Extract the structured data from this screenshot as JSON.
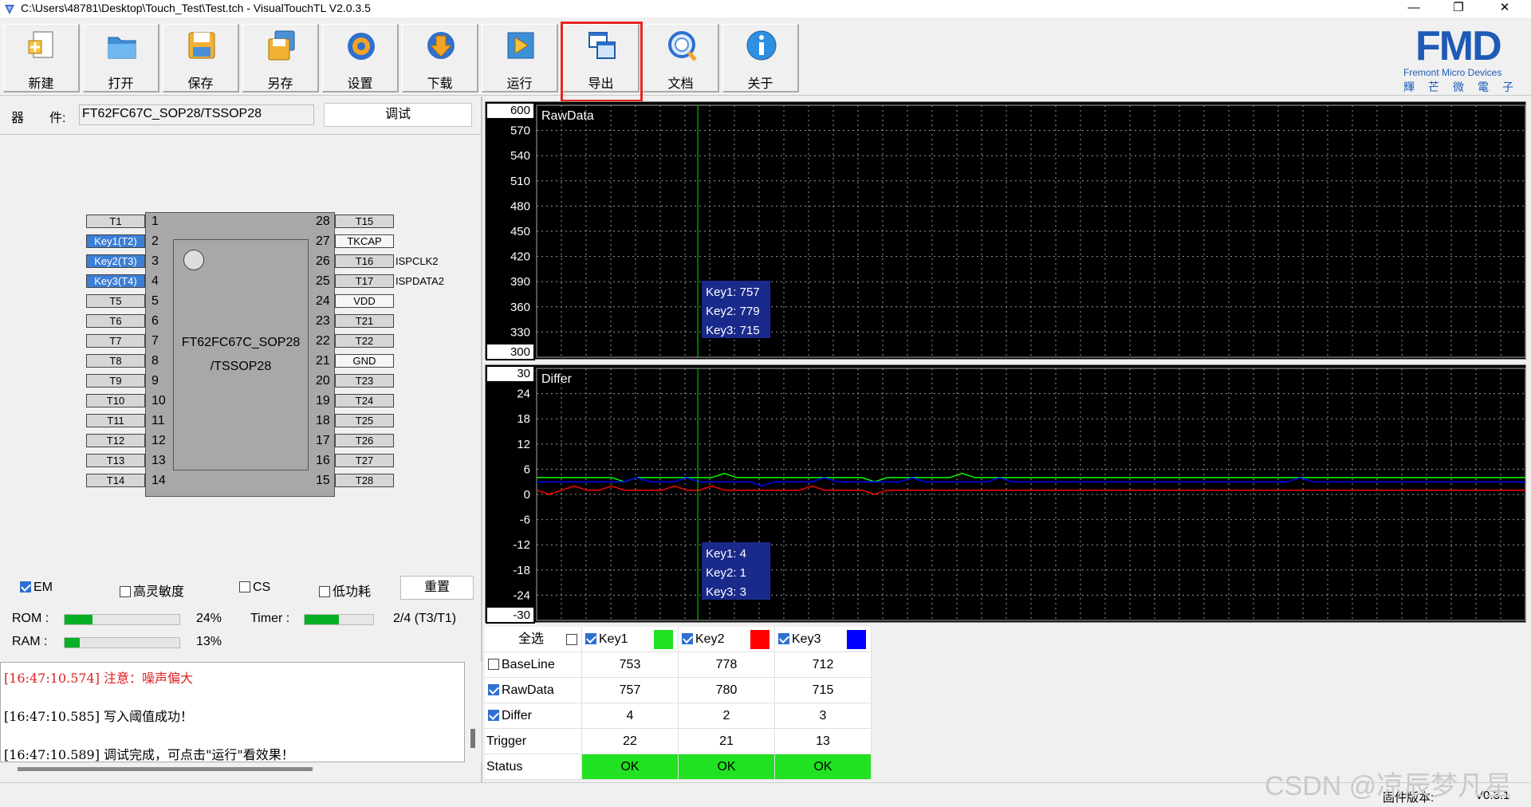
{
  "window": {
    "title": "C:\\Users\\48781\\Desktop\\Touch_Test\\Test.tch - VisualTouchTL V2.0.3.5",
    "min": "—",
    "max": "❐",
    "close": "✕"
  },
  "toolbar": {
    "items": [
      {
        "label": "新建",
        "icon": "new-file-icon"
      },
      {
        "label": "打开",
        "icon": "folder-open-icon"
      },
      {
        "label": "保存",
        "icon": "save-icon"
      },
      {
        "label": "另存",
        "icon": "save-as-icon"
      },
      {
        "label": "设置",
        "icon": "settings-gear-icon"
      },
      {
        "label": "下载",
        "icon": "download-arrow-icon"
      },
      {
        "label": "运行",
        "icon": "run-play-icon"
      },
      {
        "label": "导出",
        "icon": "export-windows-icon"
      },
      {
        "label": "文档",
        "icon": "document-search-icon"
      },
      {
        "label": "关于",
        "icon": "info-icon"
      }
    ],
    "highlight_color": "#e8231f"
  },
  "brand": {
    "logo": "FMD",
    "subtitle": "Fremont Micro Devices",
    "subtitle_cn": "輝芒微電子"
  },
  "device": {
    "label1": "器",
    "label2": "件:",
    "value": "FT62FC67C_SOP28/TSSOP28",
    "debug_button": "调试"
  },
  "chip": {
    "name_line1": "FT62FC67C_SOP28",
    "name_line2": "/TSSOP28",
    "left_pins": [
      {
        "num": "1",
        "label": "T1",
        "selected": false
      },
      {
        "num": "2",
        "label": "Key1(T2)",
        "selected": true
      },
      {
        "num": "3",
        "label": "Key2(T3)",
        "selected": true
      },
      {
        "num": "4",
        "label": "Key3(T4)",
        "selected": true
      },
      {
        "num": "5",
        "label": "T5",
        "selected": false
      },
      {
        "num": "6",
        "label": "T6",
        "selected": false
      },
      {
        "num": "7",
        "label": "T7",
        "selected": false
      },
      {
        "num": "8",
        "label": "T8",
        "selected": false
      },
      {
        "num": "9",
        "label": "T9",
        "selected": false
      },
      {
        "num": "10",
        "label": "T10",
        "selected": false
      },
      {
        "num": "11",
        "label": "T11",
        "selected": false
      },
      {
        "num": "12",
        "label": "T12",
        "selected": false
      },
      {
        "num": "13",
        "label": "T13",
        "selected": false
      },
      {
        "num": "14",
        "label": "T14",
        "selected": false
      }
    ],
    "right_pins": [
      {
        "num": "28",
        "label": "T15",
        "side": "",
        "plain": false
      },
      {
        "num": "27",
        "label": "TKCAP",
        "side": "",
        "plain": true
      },
      {
        "num": "26",
        "label": "T16",
        "side": "ISPCLK2",
        "plain": false
      },
      {
        "num": "25",
        "label": "T17",
        "side": "ISPDATA2",
        "plain": false
      },
      {
        "num": "24",
        "label": "VDD",
        "side": "",
        "plain": true
      },
      {
        "num": "23",
        "label": "T21",
        "side": "",
        "plain": false
      },
      {
        "num": "22",
        "label": "T22",
        "side": "",
        "plain": false
      },
      {
        "num": "21",
        "label": "GND",
        "side": "",
        "plain": true
      },
      {
        "num": "20",
        "label": "T23",
        "side": "",
        "plain": false
      },
      {
        "num": "19",
        "label": "T24",
        "side": "",
        "plain": false
      },
      {
        "num": "18",
        "label": "T25",
        "side": "",
        "plain": false
      },
      {
        "num": "17",
        "label": "T26",
        "side": "",
        "plain": false
      },
      {
        "num": "16",
        "label": "T27",
        "side": "",
        "plain": false
      },
      {
        "num": "15",
        "label": "T28",
        "side": "",
        "plain": false
      }
    ]
  },
  "options": {
    "em": "EM",
    "high_sens": "高灵敏度",
    "cs": "CS",
    "low_power": "低功耗",
    "reset": "重置"
  },
  "usage": {
    "rom_label": "ROM :",
    "rom_pct": "24%",
    "rom_fill": 0.24,
    "ram_label": "RAM :",
    "ram_pct": "13%",
    "ram_fill": 0.13,
    "timer_label": "Timer :",
    "timer_value": "2/4 (T3/T1)",
    "timer_fill": 0.5
  },
  "log": [
    {
      "text": "[16:47:10.574] 注意：噪声偏大",
      "color": "#e02020"
    },
    {
      "text": "[16:47:10.585] 写入阈值成功！",
      "color": "#000000"
    },
    {
      "text": "[16:47:10.589] 调试完成，可点击\"运行\"看效果！",
      "color": "#000000"
    }
  ],
  "chart_data": [
    {
      "type": "line",
      "title": "RawData",
      "ylim": [
        300,
        600
      ],
      "yticks": [
        600,
        570,
        540,
        510,
        480,
        450,
        420,
        390,
        360,
        330,
        300
      ],
      "cursor_x": 0.163,
      "tooltip": [
        "Key1: 757",
        "Key2: 779",
        "Key3: 715"
      ],
      "series": []
    },
    {
      "type": "line",
      "title": "Differ",
      "ylim": [
        -30,
        30
      ],
      "yticks": [
        30,
        24,
        18,
        12,
        6,
        0,
        -6,
        -12,
        -18,
        -24,
        -30
      ],
      "cursor_x": 0.163,
      "tooltip": [
        "Key1: 4",
        "Key2: 1",
        "Key3: 3"
      ],
      "series": [
        {
          "name": "Key1",
          "color": "#00ff00",
          "values": [
            4,
            4,
            4,
            4,
            4,
            4,
            4,
            3,
            4,
            4,
            4,
            4,
            4,
            4,
            4,
            5,
            4,
            4,
            4,
            4,
            4,
            4,
            4,
            4,
            4,
            4,
            4,
            3,
            4,
            4,
            4,
            4,
            4,
            4,
            5,
            4,
            4,
            4,
            4,
            4,
            4,
            4,
            4,
            4,
            4,
            4,
            4,
            4,
            4,
            4,
            4,
            4,
            4,
            4,
            4,
            4,
            4,
            4,
            4,
            4,
            4,
            4,
            4,
            4,
            4,
            4,
            4,
            4,
            4,
            4,
            4,
            4,
            4,
            4,
            4,
            4,
            4,
            4,
            4,
            4
          ]
        },
        {
          "name": "Key2",
          "color": "#ff0000",
          "values": [
            1,
            0,
            1,
            2,
            1,
            1,
            2,
            1,
            1,
            1,
            1,
            2,
            1,
            1,
            2,
            1,
            1,
            1,
            1,
            1,
            1,
            1,
            2,
            1,
            1,
            1,
            1,
            0,
            1,
            1,
            1,
            1,
            1,
            1,
            1,
            1,
            1,
            1,
            1,
            1,
            1,
            1,
            1,
            1,
            1,
            1,
            1,
            1,
            1,
            1,
            1,
            1,
            1,
            1,
            1,
            1,
            1,
            1,
            1,
            1,
            1,
            1,
            1,
            1,
            1,
            1,
            1,
            1,
            1,
            1,
            1,
            1,
            1,
            1,
            1,
            1,
            1,
            1,
            1,
            1
          ]
        },
        {
          "name": "Key3",
          "color": "#0000ff",
          "values": [
            3,
            3,
            3,
            3,
            3,
            3,
            3,
            3,
            4,
            3,
            3,
            3,
            4,
            3,
            3,
            3,
            3,
            3,
            2,
            3,
            3,
            3,
            3,
            4,
            3,
            3,
            3,
            3,
            3,
            3,
            4,
            3,
            3,
            3,
            3,
            3,
            3,
            4,
            3,
            3,
            3,
            3,
            3,
            3,
            3,
            3,
            3,
            3,
            3,
            3,
            3,
            3,
            3,
            3,
            3,
            3,
            3,
            3,
            3,
            3,
            3,
            4,
            3,
            3,
            3,
            3,
            3,
            3,
            3,
            3,
            3,
            3,
            3,
            3,
            3,
            3,
            3,
            3,
            3,
            3
          ]
        }
      ]
    }
  ],
  "table": {
    "select_all": "全选",
    "keys": [
      {
        "name": "Key1",
        "color": "#22e022"
      },
      {
        "name": "Key2",
        "color": "#ff0000"
      },
      {
        "name": "Key3",
        "color": "#0000ff"
      }
    ],
    "rows": [
      {
        "label": "BaseLine",
        "checked": false,
        "values": [
          "753",
          "778",
          "712"
        ]
      },
      {
        "label": "RawData",
        "checked": true,
        "values": [
          "757",
          "780",
          "715"
        ]
      },
      {
        "label": "Differ",
        "checked": true,
        "values": [
          "4",
          "2",
          "3"
        ]
      },
      {
        "label": "Trigger",
        "checked": null,
        "values": [
          "22",
          "21",
          "13"
        ]
      },
      {
        "label": "Status",
        "checked": null,
        "values": [
          "OK",
          "OK",
          "OK"
        ]
      }
    ]
  },
  "status": {
    "firmware_label": "固件版本:",
    "firmware_value": "V0.3.1"
  },
  "watermark": "CSDN @凉辰梦凡星"
}
